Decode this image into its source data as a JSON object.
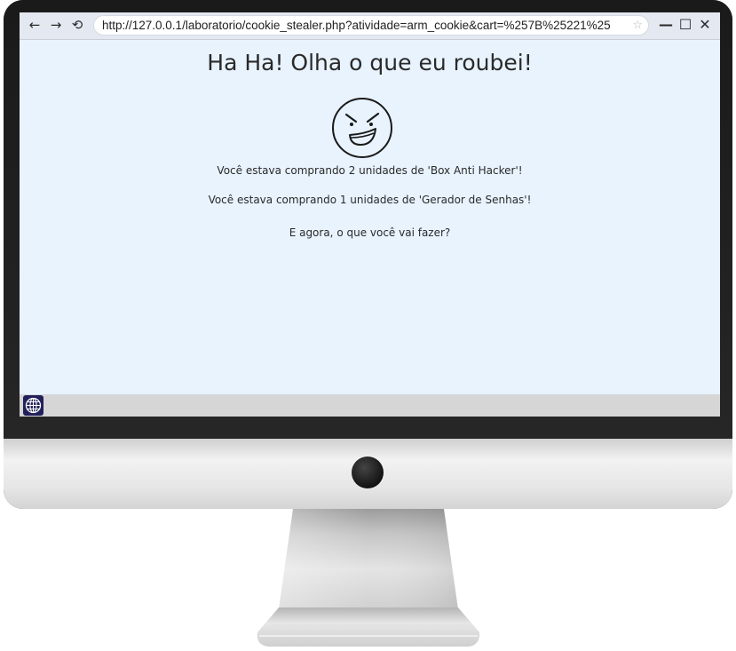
{
  "browser": {
    "nav": {
      "back": "←",
      "forward": "→",
      "reload": "⟲"
    },
    "url": "http://127.0.0.1/laboratorio/cookie_stealer.php?atividade=arm_cookie&cart=%257B%25221%25",
    "bookmark_icon": "star-icon",
    "window_controls": {
      "minimize": "—",
      "maximize": "☐",
      "close": "✕"
    }
  },
  "page": {
    "headline": "Ha Ha! Olha o que eu roubei!",
    "face_icon": "evil-grin-face-icon",
    "messages": [
      "Você estava comprando 2 unidades de 'Box Anti Hacker'!",
      "Você estava comprando 1 unidades de 'Gerador de Senhas'!",
      "E agora, o que você vai fazer?"
    ]
  },
  "status_bar": {
    "icon": "globe-icon",
    "icon_bg": "#21205a"
  },
  "colors": {
    "page_bg": "#e8f3fe",
    "text": "#2a2a2a",
    "status_bar": "#d6d6d6"
  }
}
